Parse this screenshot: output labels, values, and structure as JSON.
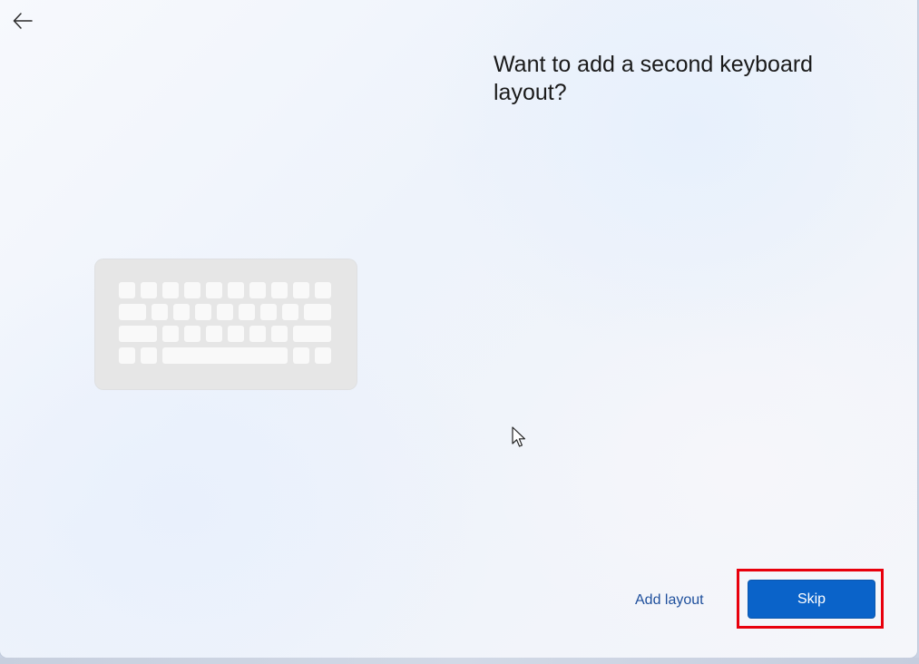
{
  "header": {
    "back_icon": "back-arrow-icon"
  },
  "main": {
    "title": "Want to add a second keyboard layout?",
    "illustration_icon": "keyboard-icon"
  },
  "footer": {
    "add_layout_label": "Add layout",
    "skip_label": "Skip"
  },
  "colors": {
    "accent": "#0a63c9",
    "link": "#1e4f9c",
    "highlight": "#e8000c"
  }
}
